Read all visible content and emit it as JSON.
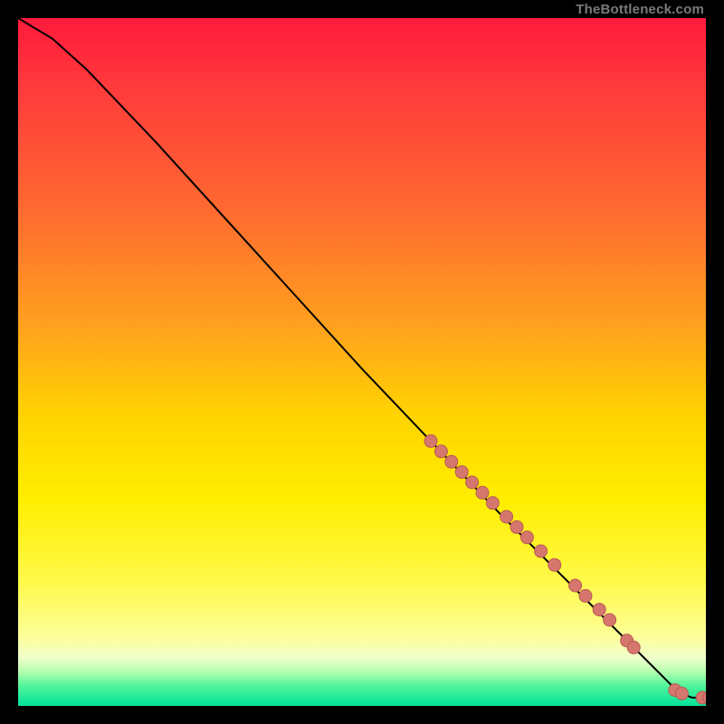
{
  "attribution": "TheBottleneck.com",
  "colors": {
    "curve": "#000000",
    "marker_fill": "#d6776e",
    "marker_stroke": "#b85a52"
  },
  "chart_data": {
    "type": "line",
    "title": "",
    "xlabel": "",
    "ylabel": "",
    "xlim": [
      0,
      100
    ],
    "ylim": [
      0,
      100
    ],
    "grid": false,
    "curve": [
      {
        "x": 0,
        "y": 100
      },
      {
        "x": 5,
        "y": 97
      },
      {
        "x": 10,
        "y": 92.5
      },
      {
        "x": 20,
        "y": 82
      },
      {
        "x": 30,
        "y": 71
      },
      {
        "x": 40,
        "y": 60
      },
      {
        "x": 50,
        "y": 49
      },
      {
        "x": 60,
        "y": 38.5
      },
      {
        "x": 70,
        "y": 28
      },
      {
        "x": 80,
        "y": 18
      },
      {
        "x": 88,
        "y": 10
      },
      {
        "x": 93,
        "y": 5
      },
      {
        "x": 96,
        "y": 2
      },
      {
        "x": 98,
        "y": 1.2
      },
      {
        "x": 100,
        "y": 1.2
      }
    ],
    "markers": [
      {
        "x": 60,
        "y": 38.5
      },
      {
        "x": 61.5,
        "y": 37
      },
      {
        "x": 63,
        "y": 35.5
      },
      {
        "x": 64.5,
        "y": 34
      },
      {
        "x": 66,
        "y": 32.5
      },
      {
        "x": 67.5,
        "y": 31
      },
      {
        "x": 69,
        "y": 29.5
      },
      {
        "x": 71,
        "y": 27.5
      },
      {
        "x": 72.5,
        "y": 26
      },
      {
        "x": 74,
        "y": 24.5
      },
      {
        "x": 76,
        "y": 22.5
      },
      {
        "x": 78,
        "y": 20.5
      },
      {
        "x": 81,
        "y": 17.5
      },
      {
        "x": 82.5,
        "y": 16
      },
      {
        "x": 84.5,
        "y": 14
      },
      {
        "x": 86,
        "y": 12.5
      },
      {
        "x": 88.5,
        "y": 9.5
      },
      {
        "x": 89.5,
        "y": 8.5
      },
      {
        "x": 95.5,
        "y": 2.3
      },
      {
        "x": 96.5,
        "y": 1.8
      },
      {
        "x": 99.5,
        "y": 1.2
      },
      {
        "x": 100.5,
        "y": 1.2
      }
    ]
  }
}
